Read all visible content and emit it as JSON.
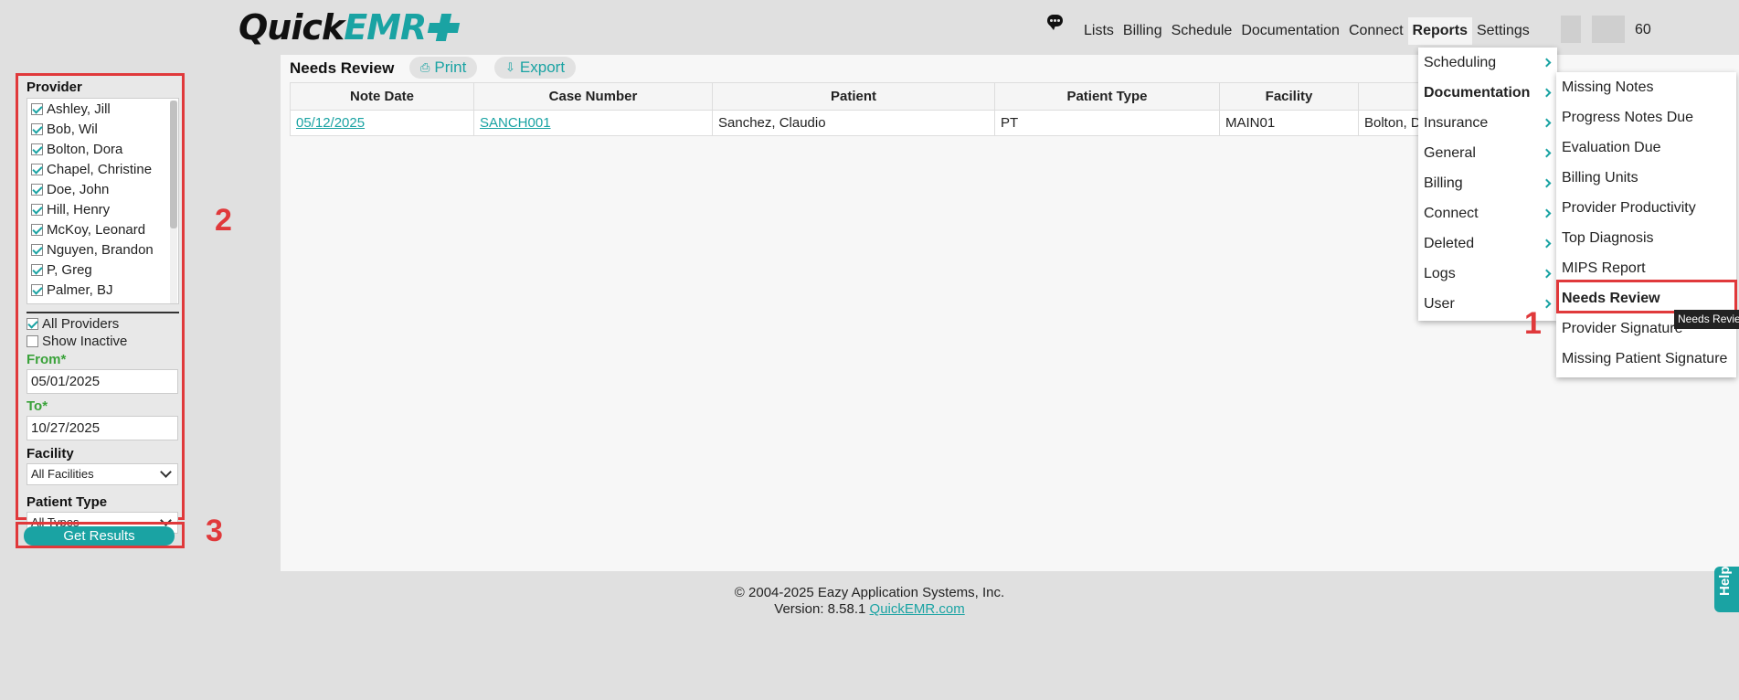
{
  "brand": {
    "name_part1": "Quick",
    "name_part2": "EMR"
  },
  "nav": {
    "items": [
      "Lists",
      "Billing",
      "Schedule",
      "Documentation",
      "Connect",
      "Reports",
      "Settings"
    ],
    "active": "Reports",
    "counter": "60"
  },
  "filters": {
    "provider_label": "Provider",
    "providers": [
      {
        "name": "Ashley, Jill",
        "checked": true
      },
      {
        "name": "Bob, Wil",
        "checked": true
      },
      {
        "name": "Bolton, Dora",
        "checked": true
      },
      {
        "name": "Chapel, Christine",
        "checked": true
      },
      {
        "name": "Doe, John",
        "checked": true
      },
      {
        "name": "Hill, Henry",
        "checked": true
      },
      {
        "name": "McKoy, Leonard",
        "checked": true
      },
      {
        "name": "Nguyen, Brandon",
        "checked": true
      },
      {
        "name": "P, Greg",
        "checked": true
      },
      {
        "name": "Palmer, BJ",
        "checked": true
      }
    ],
    "all_providers_label": "All Providers",
    "show_inactive_label": "Show Inactive",
    "from_label": "From*",
    "from_value": "05/01/2025",
    "to_label": "To*",
    "to_value": "10/27/2025",
    "facility_label": "Facility",
    "facility_value": "All Facilities",
    "patient_type_label": "Patient Type",
    "patient_type_value": "All Types",
    "get_results_label": "Get Results"
  },
  "annotations": {
    "one": "1",
    "two": "2",
    "three": "3"
  },
  "main": {
    "title": "Needs Review",
    "print_label": "Print",
    "export_label": "Export",
    "columns": [
      "Note Date",
      "Case Number",
      "Patient",
      "Patient Type",
      "Facility",
      ""
    ],
    "rows": [
      {
        "note_date": "05/12/2025",
        "case_number": "SANCH001",
        "patient": "Sanchez, Claudio",
        "patient_type": "PT",
        "facility": "MAIN01",
        "extra": "Bolton, D"
      }
    ]
  },
  "reports_menu": {
    "items": [
      "Scheduling",
      "Documentation",
      "Insurance",
      "General",
      "Billing",
      "Connect",
      "Deleted",
      "Logs",
      "User"
    ],
    "active": "Documentation"
  },
  "documentation_menu": {
    "items": [
      "Missing Notes",
      "Progress Notes Due",
      "Evaluation Due",
      "Billing Units",
      "Provider Productivity",
      "Top Diagnosis",
      "MIPS Report",
      "Needs Review",
      "Provider Signature",
      "Missing Patient Signature"
    ],
    "selected": "Needs Review",
    "tooltip": "Needs Review"
  },
  "footer": {
    "copyright": "© 2004-2025 Eazy Application Systems, Inc.",
    "version": "Version: 8.58.1",
    "link": "QuickEMR.com"
  },
  "help_label": "Help",
  "colors": {
    "accent": "#1aa3a3",
    "highlight": "#e0393b",
    "date_label": "#3aa23a"
  }
}
